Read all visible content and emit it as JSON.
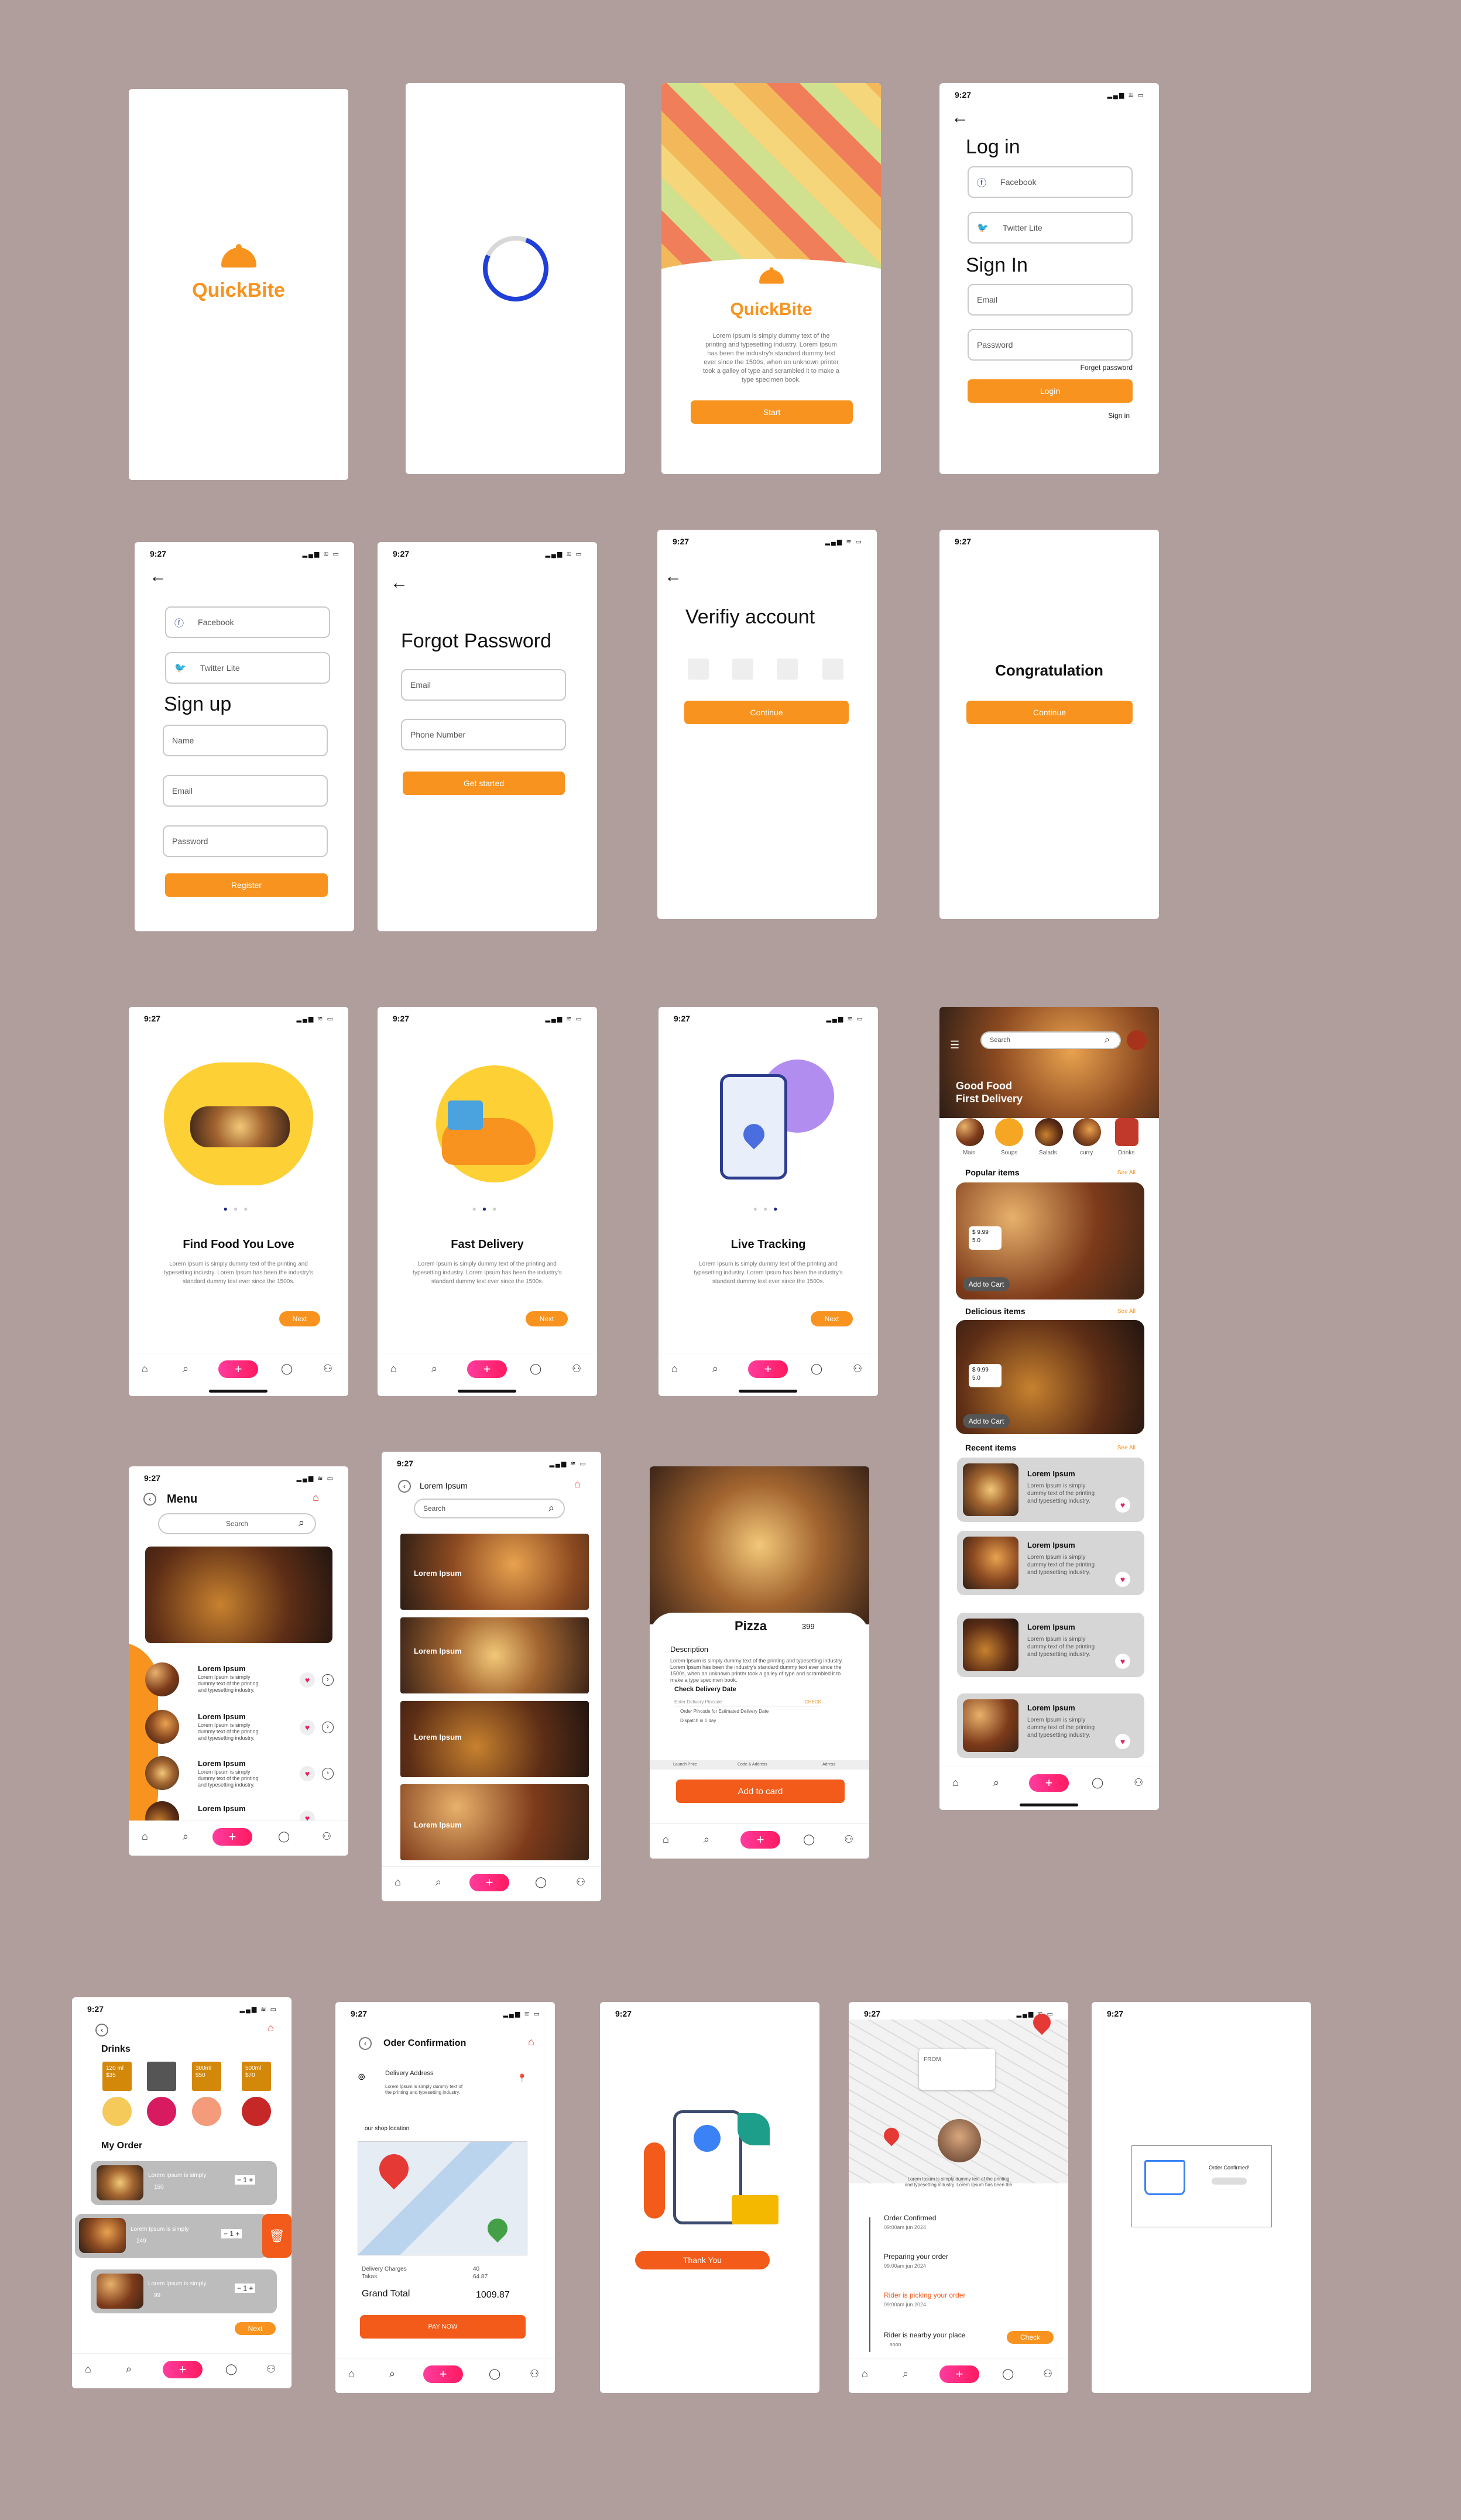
{
  "brand": "QuickBite",
  "status": {
    "time": "9:27",
    "icons": "▂▄▆ ≋ ▭"
  },
  "lorem_long": "Lorem Ipsum is simply dummy text of the printing and typesetting industry. Lorem Ipsum has been the industry's standard dummy text ever since the 1500s, when an unknown printer took a galley of type and scrambled it to make a type specimen book.",
  "lorem_short": "Lorem Ipsum is simply dummy text of the printing and typesetting industry. Lorem Ipsum has been the industry's standard dummy text ever since the 1500s.",
  "lorem_card": "Lorem Ipsum is simply dummy text of the printing and typesetting industry.",
  "welcome": {
    "start": "Start"
  },
  "login": {
    "title": "Log in",
    "facebook": "Facebook",
    "twitter": "Twitter Lite",
    "signin_title": "Sign In",
    "email": "Email",
    "password": "Password",
    "forgot": "Forget password",
    "login_btn": "Login",
    "signin_link": "Sign in"
  },
  "signup": {
    "facebook": "Facebook",
    "twitter": "Twitter Lite",
    "title": "Sign up",
    "name": "Name",
    "email": "Email",
    "password": "Password",
    "register": "Register"
  },
  "forgot": {
    "title": "Forgot Password",
    "email": "Email",
    "phone": "Phone Number",
    "button": "Get  started"
  },
  "verify": {
    "title": "Verifiy account",
    "button": "Continue"
  },
  "congrats": {
    "title": "Congratulation",
    "button": "Continue"
  },
  "onboard": [
    {
      "title": "Find Food You Love",
      "next": "Next"
    },
    {
      "title": "Fast Delivery",
      "next": "Next"
    },
    {
      "title": "Live Tracking",
      "next": "Next"
    }
  ],
  "home": {
    "search": "Search",
    "headline1": "Good Food",
    "headline2": "First Delivery",
    "cats": [
      "Main",
      "Soups",
      "Salads",
      "curry",
      "Drinks"
    ],
    "popular": "Popular items",
    "delicious": "Delicious items",
    "recent": "Recent items",
    "see_all": "See All",
    "price": "$ 9.99",
    "rating": "5.0",
    "add_to_cart": "Add to Cart",
    "item": "Lorem Ipsum"
  },
  "menu": {
    "title": "Menu",
    "search": "Search",
    "item": "Lorem Ipsum"
  },
  "list": {
    "title": "Lorem Ipsum",
    "search": "Search",
    "item": "Lorem Ipsum"
  },
  "pizza": {
    "title": "Pizza",
    "price": "399",
    "desc_label": "Description",
    "check": "Check Delivery Date",
    "enter": "Enter Delivery Pincode",
    "check_btn": "CHECK",
    "order": "Order Pincode for Estimated Delivery Date",
    "dispatch": "Dispatch in 1 day",
    "tabs": [
      "Launch Price",
      "Code & Address",
      "Adress"
    ],
    "add": "Add to card"
  },
  "order": {
    "drinks": "Drinks",
    "my_order": "My Order",
    "next": "Next",
    "prices": [
      "120 ml $35",
      "",
      "300ml $50",
      "500ml $70"
    ],
    "item": "Lorem Ipsum is simply",
    "qty": "1",
    "pr": [
      "150",
      "249",
      "99"
    ]
  },
  "confirm": {
    "title": "Oder Confirmation",
    "address": "Delivery Address",
    "shop": "our shop location",
    "delivery": "Delivery Charges",
    "takas": "Takas",
    "dc": "40",
    "tk": "64.87",
    "grand": "Grand Total",
    "total": "1009.87",
    "pay": "PAY NOW"
  },
  "thanks": {
    "button": "Thank You"
  },
  "track": {
    "from": "FROM",
    "bubble": "Lorem Ipsum is simply dummy text of the printing and typesetting industry. Lorem Ipsum has been the",
    "s1": "Order Confirmed",
    "d1": "09:00am jun 2024",
    "s2": "Preparing your order",
    "d2": "09:00am jun 2024",
    "s3": "Rider is picking your order",
    "d3": "09:00am jun 2024",
    "s4": "Rider is nearby your place",
    "d4": "soon",
    "check": "Check"
  },
  "final": {
    "text": "Order Confirmed!"
  },
  "nav": {
    "home": "⌂",
    "search": "⌕",
    "plus": "+",
    "chat": "◯",
    "user": "⚇"
  }
}
